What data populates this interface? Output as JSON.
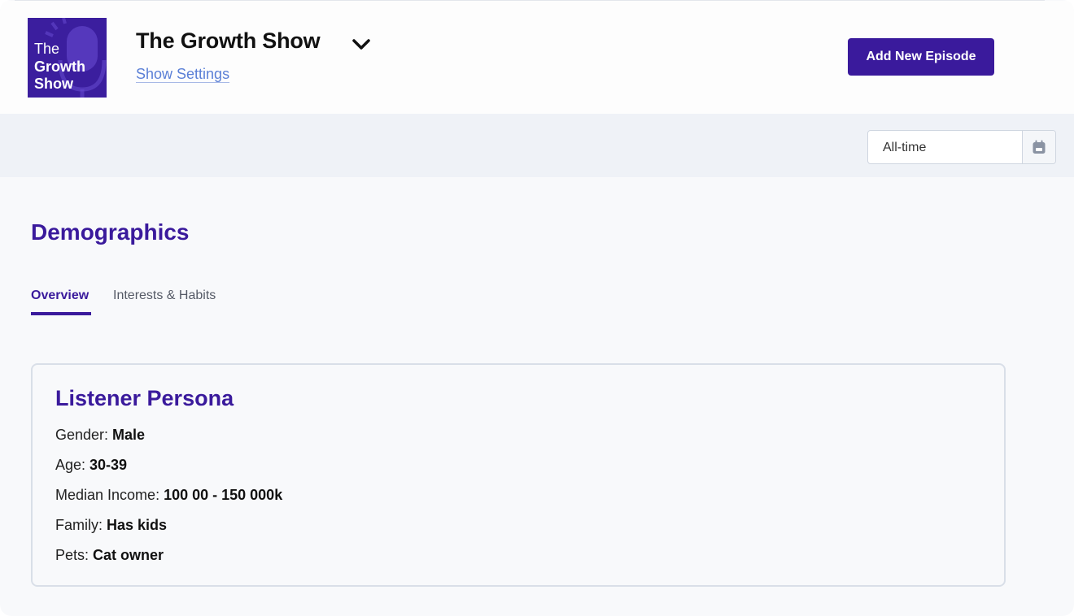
{
  "header": {
    "cover_art": {
      "line1": "The",
      "line2": "Growth",
      "line3": "Show"
    },
    "show_title": "The Growth Show",
    "show_settings_link": "Show Settings",
    "add_episode_button": "Add New Episode"
  },
  "toolbar": {
    "date_range_value": "All-time",
    "calendar_icon": "calendar-icon"
  },
  "main": {
    "section_title": "Demographics",
    "tabs": [
      {
        "label": "Overview",
        "active": true
      },
      {
        "label": "Interests & Habits",
        "active": false
      }
    ],
    "persona_card": {
      "title": "Listener Persona",
      "rows": [
        {
          "label": "Gender:",
          "value": "Male"
        },
        {
          "label": "Age:",
          "value": "30-39"
        },
        {
          "label": "Median Income:",
          "value": "100 00 - 150 000k"
        },
        {
          "label": "Family:",
          "value": "Has kids"
        },
        {
          "label": "Pets:",
          "value": "Cat owner"
        }
      ]
    }
  },
  "colors": {
    "brand_purple": "#3a1a9c",
    "link_blue": "#5a7fd6",
    "toolbar_bg": "#eff2f7"
  }
}
